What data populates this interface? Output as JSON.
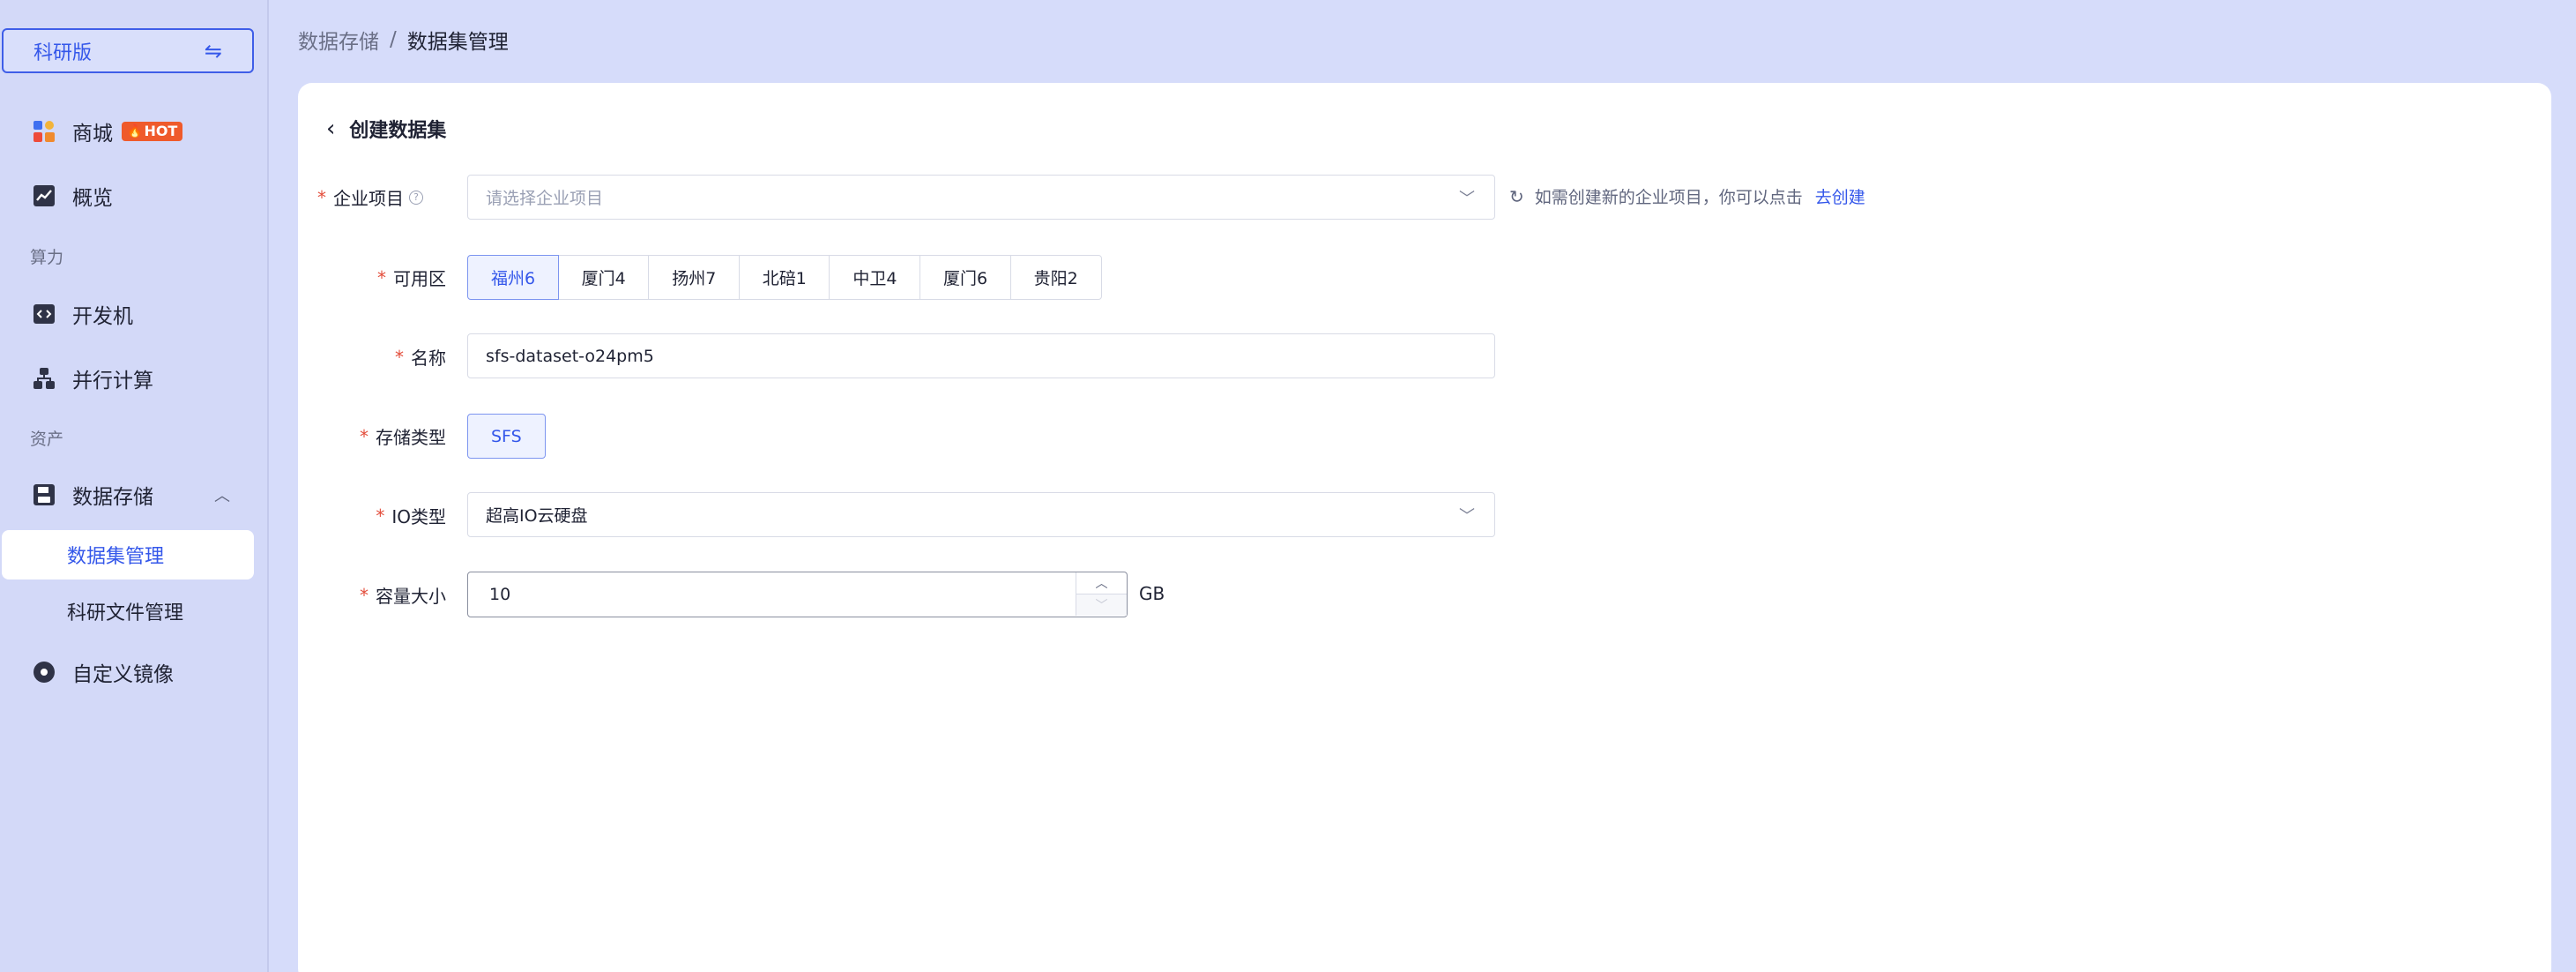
{
  "sidebar": {
    "edition_label": "科研版",
    "edition_swap_icon": "⇋",
    "mall_label": "商城",
    "hot_badge": "HOT",
    "overview_label": "概览",
    "section_compute": "算力",
    "devbox_label": "开发机",
    "parallel_label": "并行计算",
    "section_assets": "资产",
    "storage_label": "数据存储",
    "storage_sub": {
      "dataset_label": "数据集管理",
      "research_files_label": "科研文件管理"
    },
    "custom_image_label": "自定义镜像"
  },
  "breadcrumb": {
    "parent": "数据存储",
    "separator": "/",
    "current": "数据集管理"
  },
  "page": {
    "title": "创建数据集"
  },
  "form": {
    "project": {
      "label": "企业项目",
      "placeholder": "请选择企业项目",
      "hint": "如需创建新的企业项目，你可以点击",
      "create_link": "去创建"
    },
    "zone": {
      "label": "可用区",
      "options": [
        "福州6",
        "厦门4",
        "扬州7",
        "北碚1",
        "中卫4",
        "厦门6",
        "贵阳2"
      ],
      "selected": "福州6"
    },
    "name": {
      "label": "名称",
      "value": "sfs-dataset-o24pm5"
    },
    "storage_type": {
      "label": "存储类型",
      "value": "SFS"
    },
    "io_type": {
      "label": "IO类型",
      "value": "超高IO云硬盘"
    },
    "capacity": {
      "label": "容量大小",
      "value": "10",
      "unit": "GB"
    }
  },
  "colors": {
    "accent": "#3457ea",
    "page_bg": "#d6dcfa",
    "required": "#e34d3b",
    "hot_badge": "#ef5a2b"
  }
}
